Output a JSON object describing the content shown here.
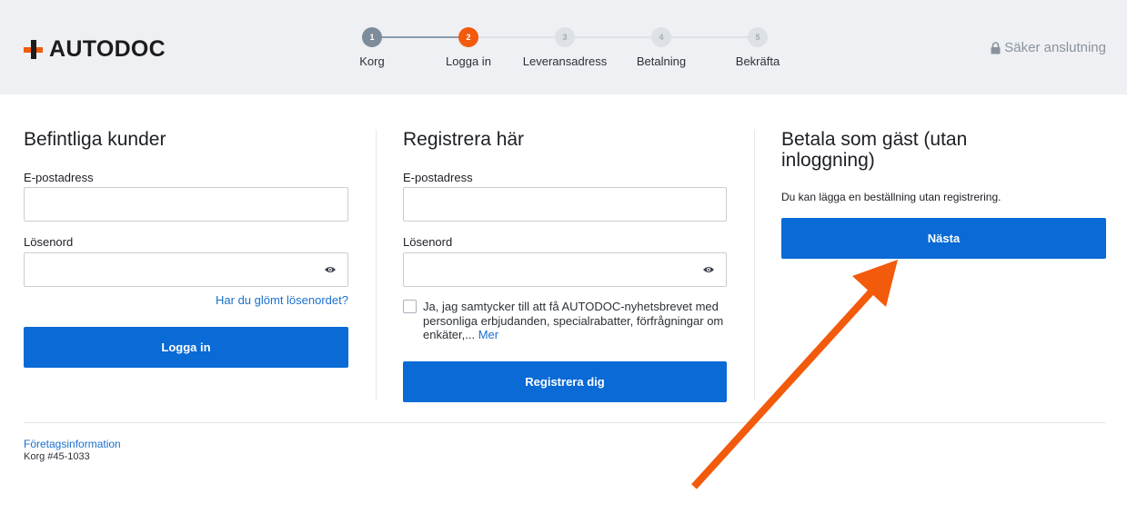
{
  "header": {
    "logo_text": "AUTODOC",
    "secure_label": "Säker anslutning",
    "steps": [
      {
        "num": "1",
        "label": "Korg",
        "state": "done"
      },
      {
        "num": "2",
        "label": "Logga in",
        "state": "active"
      },
      {
        "num": "3",
        "label": "Leveransadress",
        "state": "pending"
      },
      {
        "num": "4",
        "label": "Betalning",
        "state": "pending"
      },
      {
        "num": "5",
        "label": "Bekräfta",
        "state": "pending"
      }
    ]
  },
  "login": {
    "title": "Befintliga kunder",
    "email_label": "E-postadress",
    "email_value": "",
    "password_label": "Lösenord",
    "password_value": "",
    "forgot_label": "Har du glömt lösenordet?",
    "submit_label": "Logga in"
  },
  "register": {
    "title": "Registrera här",
    "email_label": "E-postadress",
    "email_value": "",
    "password_label": "Lösenord",
    "password_value": "",
    "consent_text": "Ja, jag samtycker till att få AUTODOC-nyhetsbrevet med personliga erbjudanden, specialrabatter, förfrågningar om enkäter,...",
    "consent_more": "Mer",
    "submit_label": "Registrera dig"
  },
  "guest": {
    "title": "Betala som gäst (utan inloggning)",
    "text": "Du kan lägga en beställning utan registrering.",
    "button_label": "Nästa"
  },
  "footer": {
    "company_link": "Företagsinformation",
    "cart_id": "Korg #45-1033"
  },
  "colors": {
    "accent_orange": "#f25a0c",
    "button_blue": "#0a6ad6",
    "link_blue": "#1a6fcf",
    "header_bg": "#eef0f3"
  },
  "icons": [
    "plus-logo-icon",
    "lock-icon",
    "eye-icon",
    "arrow-annotation-icon"
  ]
}
